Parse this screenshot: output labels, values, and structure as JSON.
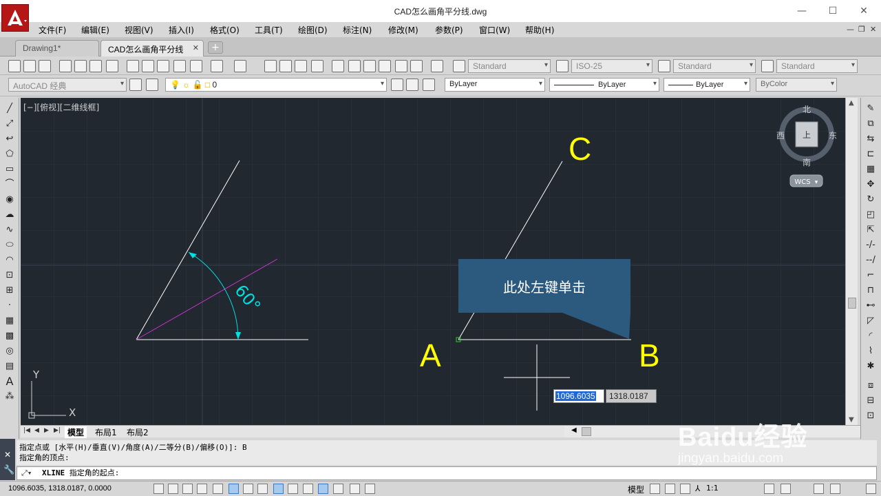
{
  "window": {
    "title": "CAD怎么画角平分线.dwg",
    "controls": [
      "—",
      "☐",
      "✕"
    ]
  },
  "menu": {
    "items": [
      "文件(F)",
      "编辑(E)",
      "视图(V)",
      "插入(I)",
      "格式(O)",
      "工具(T)",
      "绘图(D)",
      "标注(N)",
      "修改(M)",
      "参数(P)",
      "窗口(W)",
      "帮助(H)"
    ]
  },
  "tabs": [
    {
      "label": "Drawing1*",
      "active": false
    },
    {
      "label": "CAD怎么画角平分线",
      "active": true,
      "close": "✕"
    }
  ],
  "toolbar": {
    "text_style": "Standard",
    "dim_style": "ISO-25",
    "table_style": "Standard",
    "multileader_style": "Standard",
    "workspace": "AutoCAD 经典",
    "layer": "0",
    "color": "ByLayer",
    "linetype": "ByLayer",
    "lineweight": "ByLayer",
    "plotstyle": "ByColor"
  },
  "viewport": {
    "label": "[−][俯视][二维线框]"
  },
  "drawing": {
    "angle_text": "60°",
    "point_a": "A",
    "point_b": "B",
    "point_c": "C",
    "callout": "此处左键单击",
    "coord_x": "1096.6035",
    "coord_y": "1318.0187",
    "ucs_x": "X",
    "ucs_y": "Y",
    "colors": {
      "background": "#212830",
      "line": "#ffffff",
      "bisector": "#cc33cc",
      "dimension": "#00e0e0",
      "label": "#ffff00",
      "callout": "#2c5a7e"
    }
  },
  "viewcube": {
    "north": "北",
    "south": "南",
    "east": "东",
    "west": "西",
    "wcs": "WCS"
  },
  "layout_tabs": [
    "模型",
    "布局1",
    "布局2"
  ],
  "command": {
    "history_1": "指定点或 [水平(H)/垂直(V)/角度(A)/二等分(B)/偏移(O)]: B",
    "history_2": "指定角的顶点:",
    "prompt_cmd": "XLINE",
    "prompt_text": "指定角的起点:"
  },
  "status": {
    "coords": "1096.6035, 1318.0187, 0.0000",
    "model": "模型",
    "scale": "1:1"
  },
  "watermark": {
    "text": "Baidu经验",
    "url": "jingyan.baidu.com"
  }
}
